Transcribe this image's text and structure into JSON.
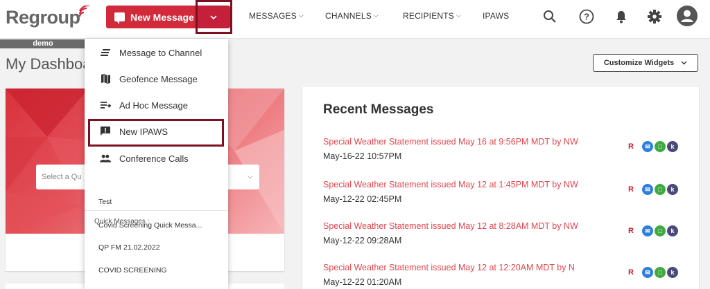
{
  "header": {
    "logo_text": "Regroup",
    "new_message_label": "New Message",
    "nav": [
      {
        "label": "MESSAGES",
        "has_dropdown": true
      },
      {
        "label": "CHANNELS",
        "has_dropdown": true
      },
      {
        "label": "RECIPIENTS",
        "has_dropdown": true
      },
      {
        "label": "IPAWS",
        "has_dropdown": false
      }
    ],
    "icons": [
      "search-icon",
      "help-icon",
      "bell-icon",
      "gear-icon",
      "user-avatar-icon"
    ]
  },
  "account_tag": "demo",
  "dashboard": {
    "title": "My Dashboard",
    "customize_label": "Customize Widgets",
    "quick_select_placeholder": "Select a Qu"
  },
  "dropdown_menu": {
    "items": [
      {
        "label": "Message to Channel",
        "icon": "channel-lines-icon"
      },
      {
        "label": "Geofence Message",
        "icon": "map-icon"
      },
      {
        "label": "Ad Hoc Message",
        "icon": "playlist-add-icon"
      },
      {
        "label": "New IPAWS",
        "icon": "alert-message-icon"
      },
      {
        "label": "Conference Calls",
        "icon": "people-icon"
      }
    ],
    "quick_section_label": "Quick Messages :",
    "quick_messages": [
      "Test",
      "Covid Screening Quick Messa...",
      "QP FM 21.02.2022",
      "COVID SCREENING"
    ]
  },
  "recent_messages": {
    "title": "Recent Messages",
    "items": [
      {
        "title": "Special Weather Statement issued May 16 at 9:56PM MDT by NW",
        "date": "May-16-22 10:57PM"
      },
      {
        "title": "Special Weather Statement issued May 12 at 1:45PM MDT by NW",
        "date": "May-12-22 02:45PM"
      },
      {
        "title": "Special Weather Statement issued May 12 at 8:28AM MDT by NW",
        "date": "May-12-22 09:28AM"
      },
      {
        "title": "Special Weather Statement issued May 12 at 12:20AM MDT by N",
        "date": "May-12-22 01:20AM"
      }
    ]
  },
  "colors": {
    "brand_red": "#d12a3a",
    "highlight_border": "#7a1020",
    "link_red": "#e0474f"
  }
}
